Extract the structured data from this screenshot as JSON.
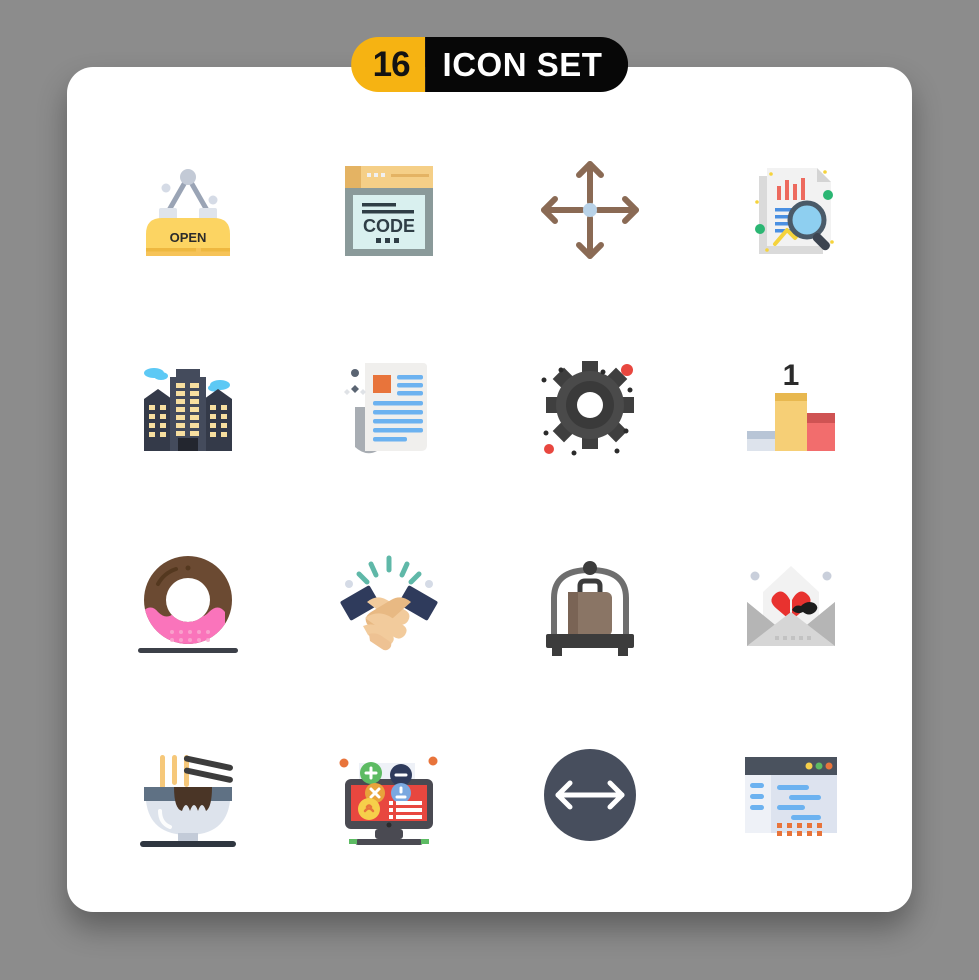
{
  "header": {
    "count": "16",
    "title": "Icon Set",
    "count_bg": "#f6b312",
    "title_bg": "#070707",
    "title_color": "#ffffff",
    "count_color": "#131313"
  },
  "page": {
    "background": "#8c8c8c",
    "card_background": "#ffffff"
  },
  "icons": [
    {
      "name": "open-sign-icon",
      "label": "OPEN",
      "text": "OPEN",
      "colors": [
        "#fcd462",
        "#f6c358",
        "#ccd1d9",
        "#aab2bd"
      ]
    },
    {
      "name": "code-browser-icon",
      "label": "CODE",
      "text": "CODE",
      "colors": [
        "#f5cf87",
        "#e4b363",
        "#8a9a9a",
        "#d9f0ef",
        "#2f3e46"
      ]
    },
    {
      "name": "move-arrows-icon",
      "label": "Move",
      "text": "",
      "colors": [
        "#8a6a54",
        "#b9d3e8"
      ]
    },
    {
      "name": "data-analysis-icon",
      "label": "Data Analysis",
      "text": "",
      "colors": [
        "#e8e8e8",
        "#ed6a5e",
        "#4a90e2",
        "#5bc0de",
        "#f5d33c",
        "#2bb673"
      ]
    },
    {
      "name": "office-building-icon",
      "label": "Office Building",
      "text": "",
      "colors": [
        "#444b5c",
        "#343a49",
        "#f7dfa0",
        "#5dc9f5"
      ]
    },
    {
      "name": "news-article-icon",
      "label": "News Article",
      "text": "",
      "colors": [
        "#f0efed",
        "#6cb2f0",
        "#e8743b",
        "#a8adb3"
      ]
    },
    {
      "name": "gear-settings-icon",
      "label": "Settings",
      "text": "",
      "colors": [
        "#4a4a4a",
        "#3a3a3a",
        "#e8473f"
      ]
    },
    {
      "name": "winner-podium-icon",
      "label": "Podium",
      "text": "1",
      "colors": [
        "#f6cf76",
        "#e8b84f",
        "#f26d6d",
        "#cf5353",
        "#b8c5d6",
        "#dde3ec",
        "#2b2b2b"
      ]
    },
    {
      "name": "donut-icon",
      "label": "Donut",
      "text": "",
      "colors": [
        "#6b4a32",
        "#f964b3",
        "#fa74bb",
        "#3c4048"
      ]
    },
    {
      "name": "handshake-icon",
      "label": "Handshake",
      "text": "",
      "colors": [
        "#2f3b5c",
        "#f2cb9c",
        "#e8b983",
        "#5fb8a8"
      ]
    },
    {
      "name": "luggage-cart-icon",
      "label": "Luggage Cart",
      "text": "",
      "colors": [
        "#3c3c3c",
        "#6e6e6e",
        "#8a7565",
        "#7a6455"
      ]
    },
    {
      "name": "love-letter-icon",
      "label": "Love Letter",
      "text": "",
      "colors": [
        "#f2f2f2",
        "#b5b5b5",
        "#d6d6d6",
        "#e8322f",
        "#1d1d1d"
      ]
    },
    {
      "name": "noodle-bowl-icon",
      "label": "Noodle Bowl",
      "text": "",
      "colors": [
        "#dde3ec",
        "#5f7184",
        "#4a3526",
        "#f6c87a",
        "#2f3640"
      ]
    },
    {
      "name": "online-ad-icon",
      "label": "Online Ad",
      "text": "",
      "colors": [
        "#4a4a52",
        "#e8473f",
        "#5dbb63",
        "#2f3b5c",
        "#f6cf4a",
        "#e8743b"
      ]
    },
    {
      "name": "resize-arrow-icon",
      "label": "Resize",
      "text": "",
      "colors": [
        "#474e5d",
        "#ffffff"
      ]
    },
    {
      "name": "dashboard-page-icon",
      "label": "Dashboard",
      "text": "",
      "colors": [
        "#4a525e",
        "#eef1f7",
        "#dde3ef",
        "#6cb2f0",
        "#e8743b",
        "#f6cf4a",
        "#5dbb63"
      ]
    }
  ]
}
